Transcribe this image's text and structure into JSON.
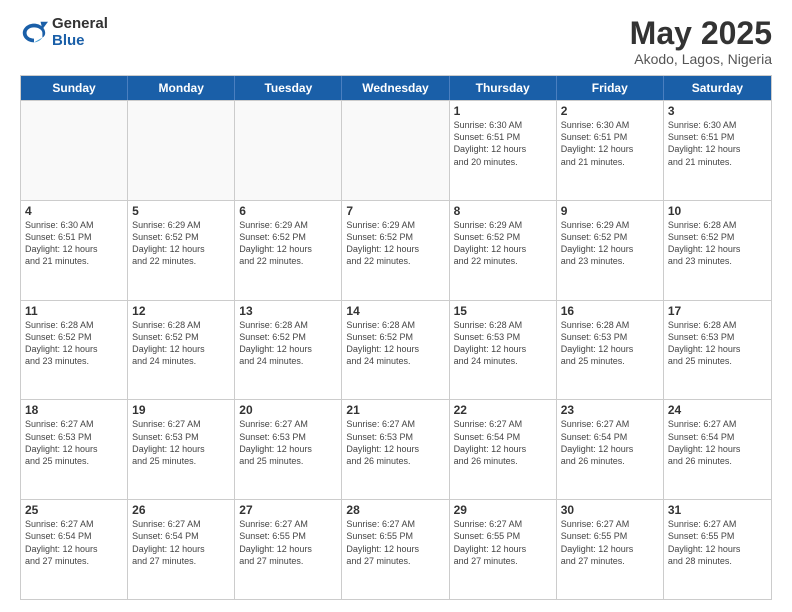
{
  "logo": {
    "general": "General",
    "blue": "Blue"
  },
  "header": {
    "title": "May 2025",
    "subtitle": "Akodo, Lagos, Nigeria"
  },
  "calendar": {
    "days_of_week": [
      "Sunday",
      "Monday",
      "Tuesday",
      "Wednesday",
      "Thursday",
      "Friday",
      "Saturday"
    ],
    "weeks": [
      [
        {
          "day": "",
          "info": "",
          "empty": true
        },
        {
          "day": "",
          "info": "",
          "empty": true
        },
        {
          "day": "",
          "info": "",
          "empty": true
        },
        {
          "day": "",
          "info": "",
          "empty": true
        },
        {
          "day": "1",
          "info": "Sunrise: 6:30 AM\nSunset: 6:51 PM\nDaylight: 12 hours\nand 20 minutes.",
          "empty": false
        },
        {
          "day": "2",
          "info": "Sunrise: 6:30 AM\nSunset: 6:51 PM\nDaylight: 12 hours\nand 21 minutes.",
          "empty": false
        },
        {
          "day": "3",
          "info": "Sunrise: 6:30 AM\nSunset: 6:51 PM\nDaylight: 12 hours\nand 21 minutes.",
          "empty": false
        }
      ],
      [
        {
          "day": "4",
          "info": "Sunrise: 6:30 AM\nSunset: 6:51 PM\nDaylight: 12 hours\nand 21 minutes.",
          "empty": false
        },
        {
          "day": "5",
          "info": "Sunrise: 6:29 AM\nSunset: 6:52 PM\nDaylight: 12 hours\nand 22 minutes.",
          "empty": false
        },
        {
          "day": "6",
          "info": "Sunrise: 6:29 AM\nSunset: 6:52 PM\nDaylight: 12 hours\nand 22 minutes.",
          "empty": false
        },
        {
          "day": "7",
          "info": "Sunrise: 6:29 AM\nSunset: 6:52 PM\nDaylight: 12 hours\nand 22 minutes.",
          "empty": false
        },
        {
          "day": "8",
          "info": "Sunrise: 6:29 AM\nSunset: 6:52 PM\nDaylight: 12 hours\nand 22 minutes.",
          "empty": false
        },
        {
          "day": "9",
          "info": "Sunrise: 6:29 AM\nSunset: 6:52 PM\nDaylight: 12 hours\nand 23 minutes.",
          "empty": false
        },
        {
          "day": "10",
          "info": "Sunrise: 6:28 AM\nSunset: 6:52 PM\nDaylight: 12 hours\nand 23 minutes.",
          "empty": false
        }
      ],
      [
        {
          "day": "11",
          "info": "Sunrise: 6:28 AM\nSunset: 6:52 PM\nDaylight: 12 hours\nand 23 minutes.",
          "empty": false
        },
        {
          "day": "12",
          "info": "Sunrise: 6:28 AM\nSunset: 6:52 PM\nDaylight: 12 hours\nand 24 minutes.",
          "empty": false
        },
        {
          "day": "13",
          "info": "Sunrise: 6:28 AM\nSunset: 6:52 PM\nDaylight: 12 hours\nand 24 minutes.",
          "empty": false
        },
        {
          "day": "14",
          "info": "Sunrise: 6:28 AM\nSunset: 6:52 PM\nDaylight: 12 hours\nand 24 minutes.",
          "empty": false
        },
        {
          "day": "15",
          "info": "Sunrise: 6:28 AM\nSunset: 6:53 PM\nDaylight: 12 hours\nand 24 minutes.",
          "empty": false
        },
        {
          "day": "16",
          "info": "Sunrise: 6:28 AM\nSunset: 6:53 PM\nDaylight: 12 hours\nand 25 minutes.",
          "empty": false
        },
        {
          "day": "17",
          "info": "Sunrise: 6:28 AM\nSunset: 6:53 PM\nDaylight: 12 hours\nand 25 minutes.",
          "empty": false
        }
      ],
      [
        {
          "day": "18",
          "info": "Sunrise: 6:27 AM\nSunset: 6:53 PM\nDaylight: 12 hours\nand 25 minutes.",
          "empty": false
        },
        {
          "day": "19",
          "info": "Sunrise: 6:27 AM\nSunset: 6:53 PM\nDaylight: 12 hours\nand 25 minutes.",
          "empty": false
        },
        {
          "day": "20",
          "info": "Sunrise: 6:27 AM\nSunset: 6:53 PM\nDaylight: 12 hours\nand 25 minutes.",
          "empty": false
        },
        {
          "day": "21",
          "info": "Sunrise: 6:27 AM\nSunset: 6:53 PM\nDaylight: 12 hours\nand 26 minutes.",
          "empty": false
        },
        {
          "day": "22",
          "info": "Sunrise: 6:27 AM\nSunset: 6:54 PM\nDaylight: 12 hours\nand 26 minutes.",
          "empty": false
        },
        {
          "day": "23",
          "info": "Sunrise: 6:27 AM\nSunset: 6:54 PM\nDaylight: 12 hours\nand 26 minutes.",
          "empty": false
        },
        {
          "day": "24",
          "info": "Sunrise: 6:27 AM\nSunset: 6:54 PM\nDaylight: 12 hours\nand 26 minutes.",
          "empty": false
        }
      ],
      [
        {
          "day": "25",
          "info": "Sunrise: 6:27 AM\nSunset: 6:54 PM\nDaylight: 12 hours\nand 27 minutes.",
          "empty": false
        },
        {
          "day": "26",
          "info": "Sunrise: 6:27 AM\nSunset: 6:54 PM\nDaylight: 12 hours\nand 27 minutes.",
          "empty": false
        },
        {
          "day": "27",
          "info": "Sunrise: 6:27 AM\nSunset: 6:55 PM\nDaylight: 12 hours\nand 27 minutes.",
          "empty": false
        },
        {
          "day": "28",
          "info": "Sunrise: 6:27 AM\nSunset: 6:55 PM\nDaylight: 12 hours\nand 27 minutes.",
          "empty": false
        },
        {
          "day": "29",
          "info": "Sunrise: 6:27 AM\nSunset: 6:55 PM\nDaylight: 12 hours\nand 27 minutes.",
          "empty": false
        },
        {
          "day": "30",
          "info": "Sunrise: 6:27 AM\nSunset: 6:55 PM\nDaylight: 12 hours\nand 27 minutes.",
          "empty": false
        },
        {
          "day": "31",
          "info": "Sunrise: 6:27 AM\nSunset: 6:55 PM\nDaylight: 12 hours\nand 28 minutes.",
          "empty": false
        }
      ]
    ]
  }
}
